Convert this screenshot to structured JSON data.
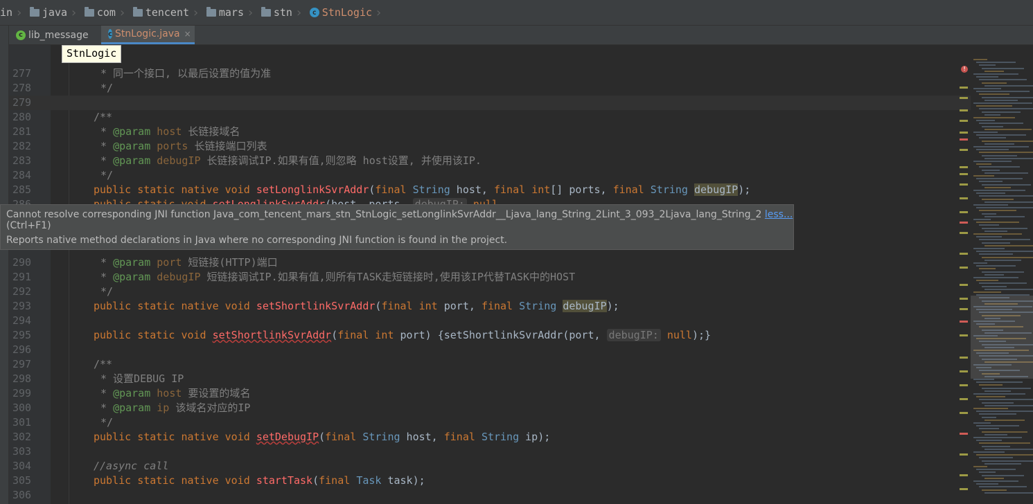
{
  "breadcrumb": [
    "in",
    "java",
    "com",
    "tencent",
    "mars",
    "stn",
    "StnLogic"
  ],
  "tabs": [
    {
      "label": "lib_message",
      "icon": "module-icon"
    },
    {
      "label": "StnLogic.java",
      "icon": "class-icon",
      "close": "×"
    }
  ],
  "hint": "StnLogic",
  "tooltip": {
    "message": "Cannot resolve corresponding JNI function Java_com_tencent_mars_stn_StnLogic_setLonglinkSvrAddr__Ljava_lang_String_2Lint_3_093_2Ljava_lang_String_2",
    "link": "less...",
    "shortcut": "(Ctrl+F1)",
    "description": "Reports native method declarations in Java where no corresponding JNI function is found in the project."
  },
  "lines": [
    {
      "n": "277",
      "t": "* 同一个接口, 以最后设置的值为准"
    },
    {
      "n": "278",
      "t": "*/"
    },
    {
      "n": "279",
      "t": ""
    },
    {
      "n": "280",
      "t": "/**"
    },
    {
      "n": "281",
      "t": "* @param host 长链接域名"
    },
    {
      "n": "282",
      "t": "* @param ports 长链接端口列表"
    },
    {
      "n": "283",
      "t": "* @param debugIP 长链接调试IP.如果有值,则忽略 host设置, 并使用该IP."
    },
    {
      "n": "284",
      "t": "*/"
    },
    {
      "n": "285",
      "t": "public static native void setLonglinkSvrAddr(final String host, final int[] ports, final String debugIP);"
    },
    {
      "n": "286",
      "t": "public static void setLonglinkSvrAddr(host, ports, debugIP: null"
    },
    {
      "n": "290",
      "t": "* @param port 短链接(HTTP)端口"
    },
    {
      "n": "291",
      "t": "* @param debugIP 短链接调试IP.如果有值,则所有TASK走短链接时,使用该IP代替TASK中的HOST"
    },
    {
      "n": "292",
      "t": "*/"
    },
    {
      "n": "293",
      "t": "public static native void setShortlinkSvrAddr(final int port, final String debugIP);"
    },
    {
      "n": "294",
      "t": ""
    },
    {
      "n": "295",
      "t": "public static void setShortlinkSvrAddr(final int port) {setShortlinkSvrAddr(port, debugIP: null);}"
    },
    {
      "n": "296",
      "t": ""
    },
    {
      "n": "297",
      "t": "/**"
    },
    {
      "n": "298",
      "t": "* 设置DEBUG IP"
    },
    {
      "n": "299",
      "t": "* @param host 要设置的域名"
    },
    {
      "n": "300",
      "t": "* @param ip 该域名对应的IP"
    },
    {
      "n": "301",
      "t": "*/"
    },
    {
      "n": "302",
      "t": "public static native void setDebugIP(final String host, final String ip);"
    },
    {
      "n": "303",
      "t": ""
    },
    {
      "n": "304",
      "t": "//async call"
    },
    {
      "n": "305",
      "t": "public static native void startTask(final Task task);"
    },
    {
      "n": "306",
      "t": ""
    }
  ],
  "colors": {
    "keyword": "#cc7832",
    "method": "#ff6b68",
    "type": "#6897bb",
    "comment": "#808080",
    "doc_tag": "#629755",
    "param": "#8a653b"
  }
}
